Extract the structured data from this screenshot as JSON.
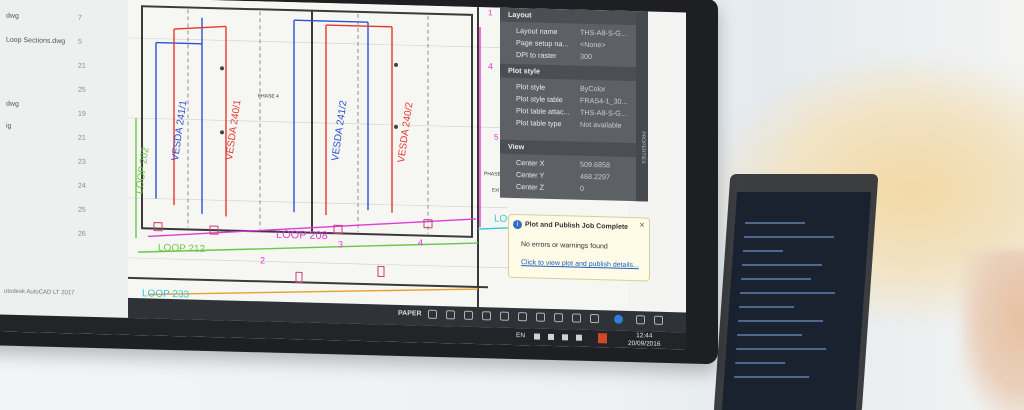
{
  "file_panel": {
    "rows": [
      {
        "label": "dwg",
        "num": "7"
      },
      {
        "label": "Loop Sections.dwg",
        "num": "5"
      },
      {
        "label": "",
        "num": "21"
      },
      {
        "label": "",
        "num": "25"
      },
      {
        "label": "dwg",
        "num": "19"
      },
      {
        "label": "ig",
        "num": "21"
      },
      {
        "label": "",
        "num": "23"
      },
      {
        "label": "",
        "num": "24"
      },
      {
        "label": "",
        "num": "25"
      },
      {
        "label": "",
        "num": "26"
      }
    ],
    "footer": "utodesk AutoCAD LT 2017"
  },
  "drawing": {
    "loops": [
      "LOOP 202",
      "LOOP 212",
      "LOOP 208",
      "LOOP 233",
      "LOOP 230"
    ],
    "vesda": [
      "VESDA 241/1",
      "VESDA 240/1",
      "VESDA 241/2",
      "VESDA 240/2"
    ],
    "phase_label": "FHASE 4",
    "phase_label2": "PHASE",
    "exit_label": "EXIT BOWL",
    "numbers": [
      "2",
      "3",
      "4",
      "4",
      "5",
      "1"
    ]
  },
  "properties": {
    "side_label": "PROPERTIES",
    "sections": [
      {
        "title": "Layout",
        "rows": [
          {
            "key": "Layout name",
            "value": "THS-A8-S-G..."
          },
          {
            "key": "Page setup na...",
            "value": "<None>"
          },
          {
            "key": "DPI to raster",
            "value": "300"
          }
        ]
      },
      {
        "title": "Plot style",
        "rows": [
          {
            "key": "Plot style",
            "value": "ByColor"
          },
          {
            "key": "Plot style table",
            "value": "FRAS4-1_30..."
          },
          {
            "key": "Plot table attac...",
            "value": "THS-A8-S-G..."
          },
          {
            "key": "Plot table type",
            "value": "Not available"
          }
        ]
      },
      {
        "title": "View",
        "rows": [
          {
            "key": "Center X",
            "value": "509.6858"
          },
          {
            "key": "Center Y",
            "value": "468.2297"
          },
          {
            "key": "Center Z",
            "value": "0"
          }
        ]
      }
    ]
  },
  "balloon": {
    "title": "Plot and Publish Job Complete",
    "message": "No errors or warnings found",
    "link": "Click to view plot and publish details..."
  },
  "statusbar": {
    "paper": "PAPER"
  },
  "taskbar": {
    "lang": "EN",
    "time": "12:44",
    "date": "20/09/2016"
  },
  "colors": {
    "accent_red": "#e8382e",
    "accent_blue": "#2e4fd6",
    "accent_magenta": "#e03bd6",
    "accent_cyan": "#34c6d6",
    "accent_green": "#6cc84a"
  }
}
